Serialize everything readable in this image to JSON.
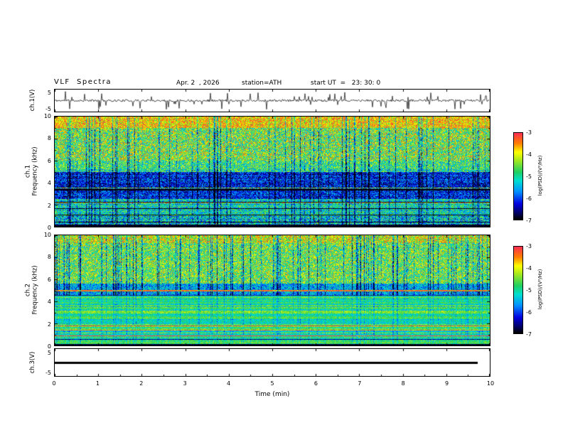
{
  "header": {
    "title": "VLF  Spectra",
    "date": "Apr. 2  , 2026",
    "station": "station=ATH",
    "start_ut": "start UT  =   23: 30: 0"
  },
  "xaxis": {
    "label": "Time  (min)",
    "range": [
      0,
      10
    ],
    "ticks": [
      0,
      1,
      2,
      3,
      4,
      5,
      6,
      7,
      8,
      9,
      10
    ]
  },
  "colorbar": {
    "label": "log(PSD)/(V²/Hz)",
    "range": [
      -7,
      -3
    ],
    "ticks": [
      -3,
      -4,
      -5,
      -6,
      -7
    ]
  },
  "colormap_stops": [
    {
      "p": 0.0,
      "c": "#000000"
    },
    {
      "p": 0.07,
      "c": "#000060"
    },
    {
      "p": 0.18,
      "c": "#0000e0"
    },
    {
      "p": 0.32,
      "c": "#0090ff"
    },
    {
      "p": 0.45,
      "c": "#00e0d0"
    },
    {
      "p": 0.55,
      "c": "#20d060"
    },
    {
      "p": 0.68,
      "c": "#a0e820"
    },
    {
      "p": 0.78,
      "c": "#ffff00"
    },
    {
      "p": 0.88,
      "c": "#ff8000"
    },
    {
      "p": 1.0,
      "c": "#ff3050"
    }
  ],
  "chart_data": [
    {
      "id": "ch1-waveform",
      "type": "line",
      "ylabel": "ch.1(V)",
      "ylim": [
        -5,
        5
      ],
      "yticks": [
        5,
        -5
      ],
      "signal": {
        "baseline_v": 0,
        "noise_amplitude_v": 0.55,
        "spike_rate": 0.09,
        "spike_amplitude_v": 4.6
      },
      "description": "broadband noisy voltage trace around 0 V with frequent impulsive spikes reaching about ±5 V"
    },
    {
      "id": "ch1-spectrogram",
      "type": "heatmap",
      "ylabel_lines": [
        "ch.1",
        "Frequency  (kHz)"
      ],
      "xlim": [
        0,
        10
      ],
      "ylim": [
        0,
        10
      ],
      "yticks": [
        0,
        2,
        4,
        6,
        8,
        10
      ],
      "value_label": "log(PSD)/(V²/Hz)",
      "value_range": [
        -7,
        -3
      ],
      "bands": [
        {
          "f": [
            9.0,
            10.01
          ],
          "level": 0.8,
          "noise": 0.2,
          "desc": "intense yellow/orange/red speckle near 10 kHz"
        },
        {
          "f": [
            6.0,
            9.0
          ],
          "level": 0.63,
          "noise": 0.3,
          "desc": "green-yellow speckle with red patches"
        },
        {
          "f": [
            5.0,
            6.0
          ],
          "level": 0.54,
          "noise": 0.25,
          "desc": "green-cyan transition"
        },
        {
          "f": [
            2.5,
            5.0
          ],
          "level": 0.21,
          "noise": 0.18,
          "desc": "dark blue quiet band with black vertical sferic lines"
        },
        {
          "f": [
            1.0,
            2.5
          ],
          "level": 0.45,
          "noise": 0.22,
          "desc": "cyan-green banded region"
        },
        {
          "f": [
            0.2,
            1.0
          ],
          "level": 0.42,
          "noise": 0.26,
          "desc": "cyan/green low-frequency band"
        },
        {
          "f": [
            0.0,
            0.2
          ],
          "level": 0.03,
          "noise": 0.04,
          "desc": "black bottom edge band"
        }
      ],
      "vertical_streaks": {
        "density": 0.15,
        "depth": 0.55
      },
      "horizontal_banding": {
        "fmax": 5.3,
        "amp": 0.06,
        "bright_rate": 0.03,
        "dark_rate": 0.06
      }
    },
    {
      "id": "ch2-spectrogram",
      "type": "heatmap",
      "ylabel_lines": [
        "ch.2",
        "Frequency  (kHz)"
      ],
      "xlim": [
        0,
        10
      ],
      "ylim": [
        0,
        10
      ],
      "yticks": [
        0,
        2,
        4,
        6,
        8,
        10
      ],
      "value_label": "log(PSD)/(V²/Hz)",
      "value_range": [
        -7,
        -3
      ],
      "bands": [
        {
          "f": [
            9.3,
            10.01
          ],
          "level": 0.72,
          "noise": 0.25,
          "desc": "orange/red speckle near 10 kHz"
        },
        {
          "f": [
            5.6,
            9.3
          ],
          "level": 0.61,
          "noise": 0.27,
          "desc": "green speckle with many dark-blue vertical sferic streaks"
        },
        {
          "f": [
            4.6,
            5.6
          ],
          "level": 0.37,
          "noise": 0.18,
          "desc": "darker band containing a red interference line near 5 kHz"
        },
        {
          "f": [
            0.15,
            4.6
          ],
          "level": 0.53,
          "noise": 0.1,
          "desc": "horizontally striped region: thin green/yellow/orange/red and dark lines (power-line / hum harmonics)"
        },
        {
          "f": [
            0.0,
            0.15
          ],
          "level": 0.03,
          "noise": 0.04,
          "desc": "black bottom edge band"
        }
      ],
      "red_lines": [
        4.95
      ],
      "vertical_streaks": {
        "density": 0.2,
        "depth": 0.6,
        "fmin": 4.6
      },
      "horizontal_banding": {
        "fmax": 4.6,
        "amp": 0.14,
        "bright_rate": 0.1,
        "dark_rate": 0.07
      }
    },
    {
      "id": "ch3-waveform",
      "type": "line",
      "ylabel": "ch.3(V)",
      "ylim": [
        -5,
        5
      ],
      "yticks": [
        5,
        -5
      ],
      "signal": {
        "constant_v": 0,
        "line_thickness_px": 3,
        "x_extent_fraction": 0.972
      },
      "description": "flat thick black trace at 0 V spanning 0 to ~9.7 min (inactive channel)"
    }
  ]
}
